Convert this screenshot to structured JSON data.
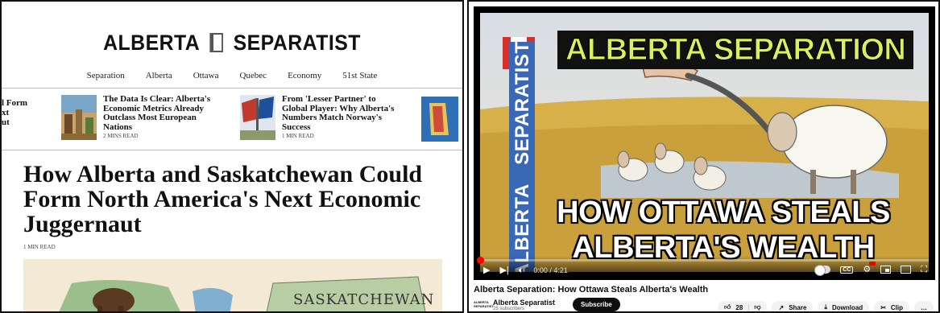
{
  "website": {
    "logo_left": "ALBERTA",
    "logo_right": "SEPARATIST",
    "nav": [
      "Separation",
      "Alberta",
      "Ottawa",
      "Quebec",
      "Economy",
      "51st State"
    ],
    "cut_off_lines": [
      "l Form",
      "xt",
      "ut"
    ],
    "stories": [
      {
        "title": "The Data Is Clear: Alberta's Economic Metrics Already Outclass Most European Nations",
        "meta": "2 MINS READ"
      },
      {
        "title": "From 'Lesser Partner' to Global Player: Why Alberta's Numbers Match Norway's Success",
        "meta": "1 MIN READ"
      }
    ],
    "headline": "How Alberta and Saskatchewan Could Form North America's Next Economic Juggernaut",
    "read_time": "1 MIN READ",
    "hero_label": "SASKATCHEWAN"
  },
  "video": {
    "thumb_top": "ALBERTA SEPARATION",
    "thumb_bottom_1": "HOW OTTAWA STEALS",
    "thumb_bottom_2": "ALBERTA'S WEALTH",
    "side_left": "ALBERTA",
    "side_right": "SEPARATIST",
    "time": "0:00 / 4:21",
    "progress": 0,
    "title": "Alberta Separation: How Ottawa Steals Alberta's Wealth",
    "channel_logo": "ALBERTA SEPARATIST",
    "channel_name": "Alberta Separatist",
    "subscribers": "25 subscribers",
    "subscribe_label": "Subscribe",
    "likes": "28",
    "share_label": "Share",
    "download_label": "Download",
    "clip_label": "Clip",
    "more_label": "…"
  },
  "colors": {
    "thumb_yellow": "#d9f15a",
    "brand_blue": "#3a68b4",
    "progress_red": "#ff0000"
  }
}
